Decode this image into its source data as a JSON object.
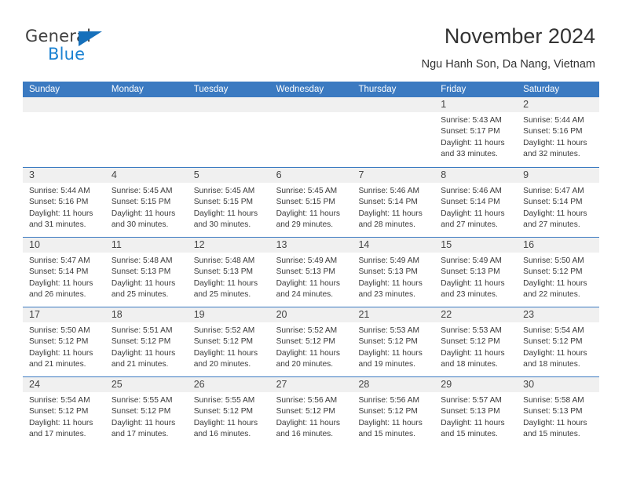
{
  "brand": {
    "name_part1": "General",
    "name_part2": "Blue",
    "triangle_icon": "blue-triangle-logo-mark"
  },
  "header": {
    "title": "November 2024",
    "subtitle": "Ngu Hanh Son, Da Nang, Vietnam"
  },
  "colors": {
    "header_blue": "#3b7ac1",
    "day_band_gray": "#f0f0f0",
    "logo_blue": "#1b82d2",
    "text": "#333333"
  },
  "weekdays": [
    "Sunday",
    "Monday",
    "Tuesday",
    "Wednesday",
    "Thursday",
    "Friday",
    "Saturday"
  ],
  "weeks": [
    {
      "days": [
        {
          "date": "",
          "sunrise": "",
          "sunset": "",
          "daylight_line1": "",
          "daylight_line2": ""
        },
        {
          "date": "",
          "sunrise": "",
          "sunset": "",
          "daylight_line1": "",
          "daylight_line2": ""
        },
        {
          "date": "",
          "sunrise": "",
          "sunset": "",
          "daylight_line1": "",
          "daylight_line2": ""
        },
        {
          "date": "",
          "sunrise": "",
          "sunset": "",
          "daylight_line1": "",
          "daylight_line2": ""
        },
        {
          "date": "",
          "sunrise": "",
          "sunset": "",
          "daylight_line1": "",
          "daylight_line2": ""
        },
        {
          "date": "1",
          "sunrise": "Sunrise: 5:43 AM",
          "sunset": "Sunset: 5:17 PM",
          "daylight_line1": "Daylight: 11 hours",
          "daylight_line2": "and 33 minutes."
        },
        {
          "date": "2",
          "sunrise": "Sunrise: 5:44 AM",
          "sunset": "Sunset: 5:16 PM",
          "daylight_line1": "Daylight: 11 hours",
          "daylight_line2": "and 32 minutes."
        }
      ]
    },
    {
      "days": [
        {
          "date": "3",
          "sunrise": "Sunrise: 5:44 AM",
          "sunset": "Sunset: 5:16 PM",
          "daylight_line1": "Daylight: 11 hours",
          "daylight_line2": "and 31 minutes."
        },
        {
          "date": "4",
          "sunrise": "Sunrise: 5:45 AM",
          "sunset": "Sunset: 5:15 PM",
          "daylight_line1": "Daylight: 11 hours",
          "daylight_line2": "and 30 minutes."
        },
        {
          "date": "5",
          "sunrise": "Sunrise: 5:45 AM",
          "sunset": "Sunset: 5:15 PM",
          "daylight_line1": "Daylight: 11 hours",
          "daylight_line2": "and 30 minutes."
        },
        {
          "date": "6",
          "sunrise": "Sunrise: 5:45 AM",
          "sunset": "Sunset: 5:15 PM",
          "daylight_line1": "Daylight: 11 hours",
          "daylight_line2": "and 29 minutes."
        },
        {
          "date": "7",
          "sunrise": "Sunrise: 5:46 AM",
          "sunset": "Sunset: 5:14 PM",
          "daylight_line1": "Daylight: 11 hours",
          "daylight_line2": "and 28 minutes."
        },
        {
          "date": "8",
          "sunrise": "Sunrise: 5:46 AM",
          "sunset": "Sunset: 5:14 PM",
          "daylight_line1": "Daylight: 11 hours",
          "daylight_line2": "and 27 minutes."
        },
        {
          "date": "9",
          "sunrise": "Sunrise: 5:47 AM",
          "sunset": "Sunset: 5:14 PM",
          "daylight_line1": "Daylight: 11 hours",
          "daylight_line2": "and 27 minutes."
        }
      ]
    },
    {
      "days": [
        {
          "date": "10",
          "sunrise": "Sunrise: 5:47 AM",
          "sunset": "Sunset: 5:14 PM",
          "daylight_line1": "Daylight: 11 hours",
          "daylight_line2": "and 26 minutes."
        },
        {
          "date": "11",
          "sunrise": "Sunrise: 5:48 AM",
          "sunset": "Sunset: 5:13 PM",
          "daylight_line1": "Daylight: 11 hours",
          "daylight_line2": "and 25 minutes."
        },
        {
          "date": "12",
          "sunrise": "Sunrise: 5:48 AM",
          "sunset": "Sunset: 5:13 PM",
          "daylight_line1": "Daylight: 11 hours",
          "daylight_line2": "and 25 minutes."
        },
        {
          "date": "13",
          "sunrise": "Sunrise: 5:49 AM",
          "sunset": "Sunset: 5:13 PM",
          "daylight_line1": "Daylight: 11 hours",
          "daylight_line2": "and 24 minutes."
        },
        {
          "date": "14",
          "sunrise": "Sunrise: 5:49 AM",
          "sunset": "Sunset: 5:13 PM",
          "daylight_line1": "Daylight: 11 hours",
          "daylight_line2": "and 23 minutes."
        },
        {
          "date": "15",
          "sunrise": "Sunrise: 5:49 AM",
          "sunset": "Sunset: 5:13 PM",
          "daylight_line1": "Daylight: 11 hours",
          "daylight_line2": "and 23 minutes."
        },
        {
          "date": "16",
          "sunrise": "Sunrise: 5:50 AM",
          "sunset": "Sunset: 5:12 PM",
          "daylight_line1": "Daylight: 11 hours",
          "daylight_line2": "and 22 minutes."
        }
      ]
    },
    {
      "days": [
        {
          "date": "17",
          "sunrise": "Sunrise: 5:50 AM",
          "sunset": "Sunset: 5:12 PM",
          "daylight_line1": "Daylight: 11 hours",
          "daylight_line2": "and 21 minutes."
        },
        {
          "date": "18",
          "sunrise": "Sunrise: 5:51 AM",
          "sunset": "Sunset: 5:12 PM",
          "daylight_line1": "Daylight: 11 hours",
          "daylight_line2": "and 21 minutes."
        },
        {
          "date": "19",
          "sunrise": "Sunrise: 5:52 AM",
          "sunset": "Sunset: 5:12 PM",
          "daylight_line1": "Daylight: 11 hours",
          "daylight_line2": "and 20 minutes."
        },
        {
          "date": "20",
          "sunrise": "Sunrise: 5:52 AM",
          "sunset": "Sunset: 5:12 PM",
          "daylight_line1": "Daylight: 11 hours",
          "daylight_line2": "and 20 minutes."
        },
        {
          "date": "21",
          "sunrise": "Sunrise: 5:53 AM",
          "sunset": "Sunset: 5:12 PM",
          "daylight_line1": "Daylight: 11 hours",
          "daylight_line2": "and 19 minutes."
        },
        {
          "date": "22",
          "sunrise": "Sunrise: 5:53 AM",
          "sunset": "Sunset: 5:12 PM",
          "daylight_line1": "Daylight: 11 hours",
          "daylight_line2": "and 18 minutes."
        },
        {
          "date": "23",
          "sunrise": "Sunrise: 5:54 AM",
          "sunset": "Sunset: 5:12 PM",
          "daylight_line1": "Daylight: 11 hours",
          "daylight_line2": "and 18 minutes."
        }
      ]
    },
    {
      "days": [
        {
          "date": "24",
          "sunrise": "Sunrise: 5:54 AM",
          "sunset": "Sunset: 5:12 PM",
          "daylight_line1": "Daylight: 11 hours",
          "daylight_line2": "and 17 minutes."
        },
        {
          "date": "25",
          "sunrise": "Sunrise: 5:55 AM",
          "sunset": "Sunset: 5:12 PM",
          "daylight_line1": "Daylight: 11 hours",
          "daylight_line2": "and 17 minutes."
        },
        {
          "date": "26",
          "sunrise": "Sunrise: 5:55 AM",
          "sunset": "Sunset: 5:12 PM",
          "daylight_line1": "Daylight: 11 hours",
          "daylight_line2": "and 16 minutes."
        },
        {
          "date": "27",
          "sunrise": "Sunrise: 5:56 AM",
          "sunset": "Sunset: 5:12 PM",
          "daylight_line1": "Daylight: 11 hours",
          "daylight_line2": "and 16 minutes."
        },
        {
          "date": "28",
          "sunrise": "Sunrise: 5:56 AM",
          "sunset": "Sunset: 5:12 PM",
          "daylight_line1": "Daylight: 11 hours",
          "daylight_line2": "and 15 minutes."
        },
        {
          "date": "29",
          "sunrise": "Sunrise: 5:57 AM",
          "sunset": "Sunset: 5:13 PM",
          "daylight_line1": "Daylight: 11 hours",
          "daylight_line2": "and 15 minutes."
        },
        {
          "date": "30",
          "sunrise": "Sunrise: 5:58 AM",
          "sunset": "Sunset: 5:13 PM",
          "daylight_line1": "Daylight: 11 hours",
          "daylight_line2": "and 15 minutes."
        }
      ]
    }
  ]
}
